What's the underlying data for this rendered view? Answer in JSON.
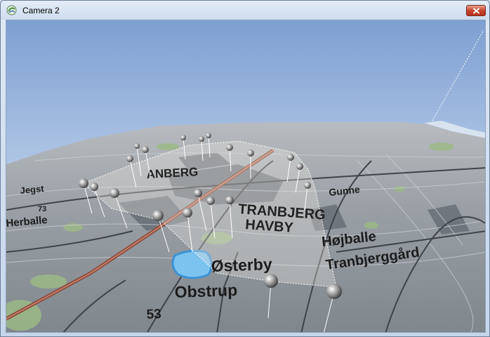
{
  "window": {
    "title": "Camera 2",
    "app_icon": "app-logo-icon",
    "close_icon": "close-icon"
  },
  "map": {
    "labels": {
      "tranbjerg": "TRANBJERG",
      "havbygade": "HAVBY",
      "anberg": "ANBERG",
      "osterby": "Østerby",
      "obstrup": "Obstrup",
      "hojballe": "Højballe",
      "tranbjerggard": "Tranbjerggård",
      "gunnestrup": "Gunne",
      "jegstrup": "Jegst",
      "herballe": "Herballe",
      "number_53": "53",
      "number_73": "73"
    },
    "colors": {
      "sky_top": "#7d9fd3",
      "sky_bottom": "#dbe6f3",
      "terrain": "#8f969d",
      "road": "#9a4a3c",
      "water": "#4da3e0"
    }
  }
}
